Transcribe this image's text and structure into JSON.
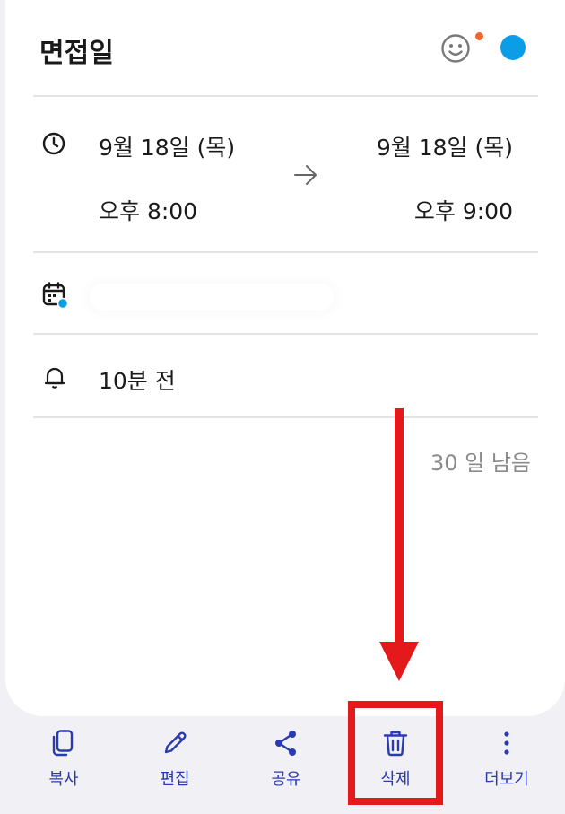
{
  "event": {
    "title": "면접일",
    "start": {
      "date": "9월 18일 (목)",
      "time": "오후 8:00"
    },
    "end": {
      "date": "9월 18일 (목)",
      "time": "오후 9:00"
    },
    "reminder": "10분 전",
    "days_remaining": "30 일 남음",
    "calendar_color": "#0b9de6",
    "notification_dot_color": "#f0662b"
  },
  "toolbar": {
    "items": [
      {
        "id": "copy",
        "label": "복사",
        "icon": "copy-icon"
      },
      {
        "id": "edit",
        "label": "편집",
        "icon": "pencil-icon"
      },
      {
        "id": "share",
        "label": "공유",
        "icon": "share-icon"
      },
      {
        "id": "delete",
        "label": "삭제",
        "icon": "trash-icon"
      },
      {
        "id": "more",
        "label": "더보기",
        "icon": "more-vertical-icon"
      }
    ],
    "icon_color": "#2a3ab0"
  },
  "annotation": {
    "color": "#e3191c",
    "highlighted_item": "delete"
  }
}
